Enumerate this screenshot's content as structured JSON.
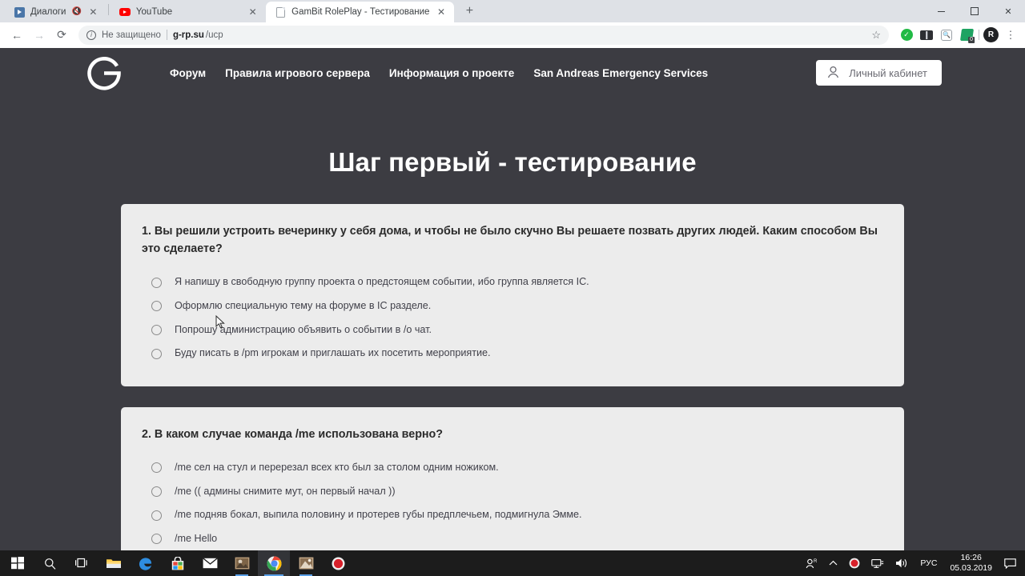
{
  "browser": {
    "tabs": [
      {
        "title": "Диалоги",
        "favicon": "vk-icon",
        "active": false,
        "muted": true
      },
      {
        "title": "YouTube",
        "favicon": "youtube-icon",
        "active": false,
        "muted": false
      },
      {
        "title": "GamBit RolePlay - Тестирование",
        "favicon": "document-icon",
        "active": true,
        "muted": false
      }
    ],
    "new_tab_label": "+",
    "window_controls": {
      "minimize": "minimize-icon",
      "maximize": "maximize-icon",
      "close": "close-icon"
    },
    "toolbar": {
      "back": "←",
      "forward": "→",
      "reload": "⟳",
      "security_text": "Не защищено",
      "url_host": "g-rp.su",
      "url_path": "/ucp",
      "star": "☆",
      "extensions": [
        "check-extension-icon",
        "dark-extension-icon",
        "magnifier-extension-icon",
        "green-extension-icon"
      ],
      "extension_badge": "0",
      "profile_initial": "R",
      "menu": "⋮"
    }
  },
  "site": {
    "logo": "gambit-g-logo",
    "nav": [
      {
        "label": "Форум"
      },
      {
        "label": "Правила игрового сервера"
      },
      {
        "label": "Информация о проекте"
      },
      {
        "label": "San Andreas Emergency Services"
      }
    ],
    "account_button": {
      "label": "Личный кабинет",
      "icon": "user-icon"
    },
    "page_title": "Шаг первый - тестирование",
    "colors": {
      "page_background": "#3c3c42",
      "card_background": "#ececec",
      "title_text": "#ffffff",
      "accent_white": "#ffffff"
    },
    "questions": [
      {
        "text": "1. Вы решили устроить вечеринку у себя дома, и чтобы не было скучно Вы решаете позвать других людей. Каким способом Вы это сделаете?",
        "options": [
          "Я напишу в свободную группу проекта о предстоящем событии, ибо группа является IC.",
          "Оформлю специальную тему на форуме в IC разделе.",
          "Попрошу администрацию объявить о событии в /о чат.",
          "Буду писать в /pm игрокам и приглашать их посетить мероприятие."
        ]
      },
      {
        "text": "2. В каком случае команда /me использована верно?",
        "options": [
          "/me сел на стул и перерезал всех кто был за столом одним ножиком.",
          "/me (( админы снимите мут, он первый начал ))",
          "/me подняв бокал, выпила половину и протерев губы предплечьем, подмигнула Эмме.",
          "/me Hello"
        ]
      }
    ]
  },
  "taskbar": {
    "items": [
      {
        "name": "start-button",
        "icon": "windows-logo-icon"
      },
      {
        "name": "search-button",
        "icon": "search-icon"
      },
      {
        "name": "task-view-button",
        "icon": "task-view-icon"
      },
      {
        "name": "file-explorer",
        "icon": "folder-icon"
      },
      {
        "name": "edge-browser",
        "icon": "edge-icon"
      },
      {
        "name": "microsoft-store",
        "icon": "store-icon"
      },
      {
        "name": "mail-app",
        "icon": "mail-icon"
      },
      {
        "name": "photos-app",
        "icon": "photo-icon"
      },
      {
        "name": "chrome-browser",
        "icon": "chrome-icon"
      },
      {
        "name": "image-app",
        "icon": "picture-icon"
      },
      {
        "name": "recorder-app",
        "icon": "record-icon"
      }
    ],
    "tray": {
      "people": "people-icon",
      "chevron": "chevron-up-icon",
      "record": "record-icon",
      "network": "network-icon",
      "volume": "volume-icon",
      "language": "РУС",
      "time": "16:26",
      "date": "05.03.2019",
      "notifications": "notification-icon"
    }
  }
}
